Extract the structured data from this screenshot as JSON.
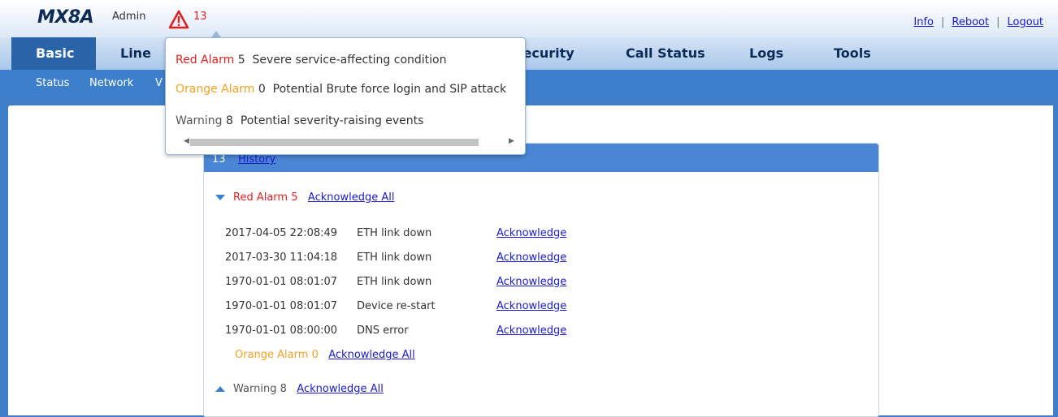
{
  "header": {
    "logo": "MX8A",
    "user": "Admin",
    "alarm_count": "13",
    "links": {
      "info": "Info",
      "reboot": "Reboot",
      "logout": "Logout"
    },
    "separator": "|"
  },
  "main_nav": {
    "tabs": [
      {
        "label": "Basic",
        "active": true
      },
      {
        "label": "Line"
      },
      {
        "label": "Security"
      },
      {
        "label": "Call Status"
      },
      {
        "label": "Logs"
      },
      {
        "label": "Tools"
      }
    ]
  },
  "sub_nav": {
    "items": [
      {
        "label": "Status"
      },
      {
        "label": "Network"
      },
      {
        "label": "V"
      }
    ]
  },
  "popup": {
    "red": {
      "label": "Red Alarm",
      "count": "5",
      "desc": "Severe service-affecting condition"
    },
    "orange": {
      "label": "Orange Alarm",
      "count": "0",
      "desc": "Potential Brute force login and SIP attack"
    },
    "warning": {
      "label": "Warning",
      "count": "8",
      "desc": "Potential severity-raising events"
    }
  },
  "history": {
    "count": "13",
    "link": "History",
    "red_group": {
      "label": "Red Alarm",
      "count": "5",
      "ack_all": "Acknowledge All"
    },
    "rows": [
      {
        "time": "2017-04-05 22:08:49",
        "event": "ETH link down",
        "action": "Acknowledge"
      },
      {
        "time": "2017-03-30 11:04:18",
        "event": "ETH link down",
        "action": "Acknowledge"
      },
      {
        "time": "1970-01-01 08:01:07",
        "event": "ETH link down",
        "action": "Acknowledge"
      },
      {
        "time": "1970-01-01 08:01:07",
        "event": "Device re-start",
        "action": "Acknowledge"
      },
      {
        "time": "1970-01-01 08:00:00",
        "event": "DNS error",
        "action": "Acknowledge"
      }
    ],
    "orange_group": {
      "label": "Orange Alarm",
      "count": "0",
      "ack_all": "Acknowledge All"
    },
    "warning_group": {
      "label": "Warning",
      "count": "8",
      "ack_all": "Acknowledge All"
    }
  },
  "colors": {
    "red": "#e02020",
    "orange": "#f4a020",
    "nav_active": "#2964a8",
    "subnav": "#3d7fcb"
  }
}
